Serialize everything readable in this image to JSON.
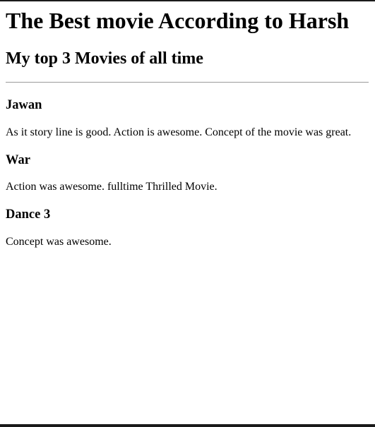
{
  "header": {
    "title": "The Best movie According to Harsh",
    "subtitle": "My top 3 Movies of all time"
  },
  "movies": [
    {
      "name": "Jawan",
      "review": "As it story line is good. Action is awesome. Concept of the movie was great."
    },
    {
      "name": "War",
      "review": "Action was awesome. fulltime Thrilled Movie."
    },
    {
      "name": "Dance 3",
      "review": "Concept was awesome."
    }
  ]
}
